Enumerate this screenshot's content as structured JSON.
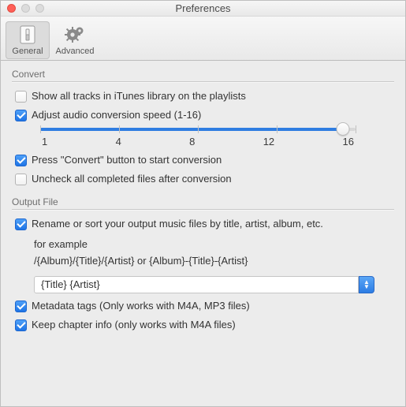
{
  "window": {
    "title": "Preferences"
  },
  "toolbar": {
    "general": "General",
    "advanced": "Advanced"
  },
  "convert": {
    "title": "Convert",
    "show_all": "Show all tracks in iTunes library on the playlists",
    "adjust_speed": "Adjust audio conversion speed (1-16)",
    "slider": {
      "ticks": [
        "1",
        "4",
        "8",
        "12",
        "16"
      ]
    },
    "press_convert": "Press \"Convert\" button to start conversion",
    "uncheck_completed": "Uncheck all completed files after conversion"
  },
  "output": {
    "title": "Output File",
    "rename_label": "Rename or sort your output music files by title, artist, album, etc.",
    "example_line": "for example",
    "example_pattern": "/{Album}/{Title}/{Artist} or {Album}-{Title}-{Artist}",
    "pattern_value": "{Title} {Artist}",
    "metadata": "Metadata tags (Only works with M4A, MP3 files)",
    "chapter": "Keep chapter info (only works with  M4A files)"
  }
}
